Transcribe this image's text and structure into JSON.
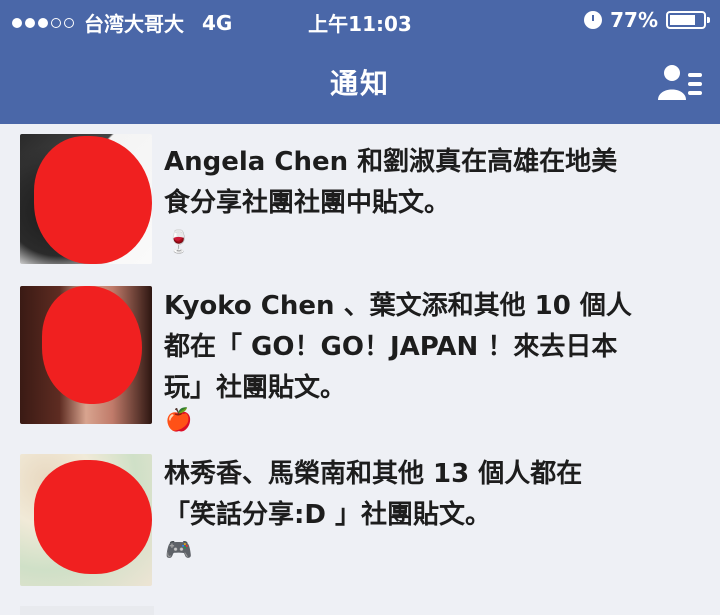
{
  "status_bar": {
    "carrier": "台湾大哥大",
    "network": "4G",
    "time": "上午11:03",
    "battery": "77%",
    "battery_level": 0.77,
    "signal_filled": 3,
    "signal_total": 5
  },
  "nav": {
    "title": "通知"
  },
  "notifications": [
    {
      "line1_name": "Angela Chen",
      "line1_rest": " 和劉淑真在高雄在地美",
      "line2": "食分享社團社團中貼文。",
      "line3": "",
      "emoji": "🍷",
      "emoji_icon": "wine-glass-icon"
    },
    {
      "line1_name": "Kyoko Chen",
      "line1_rest": " 、葉文添和其他 10 個人",
      "line2": "都在「 GO！GO！JAPAN ！來去日本",
      "line3": "玩」社團貼文。",
      "emoji": "🍎",
      "emoji_icon": "apple-icon"
    },
    {
      "line1_name": "",
      "line1_rest": "林秀香、馬榮南和其他 13 個人都在",
      "line2": "「笑話分享:D 」社團貼文。",
      "line3": "",
      "emoji": "🎮",
      "emoji_icon": "game-controller-icon"
    }
  ],
  "colors": {
    "header": "#4a67a8",
    "background": "#eef0f5",
    "redaction": "#f02020"
  }
}
